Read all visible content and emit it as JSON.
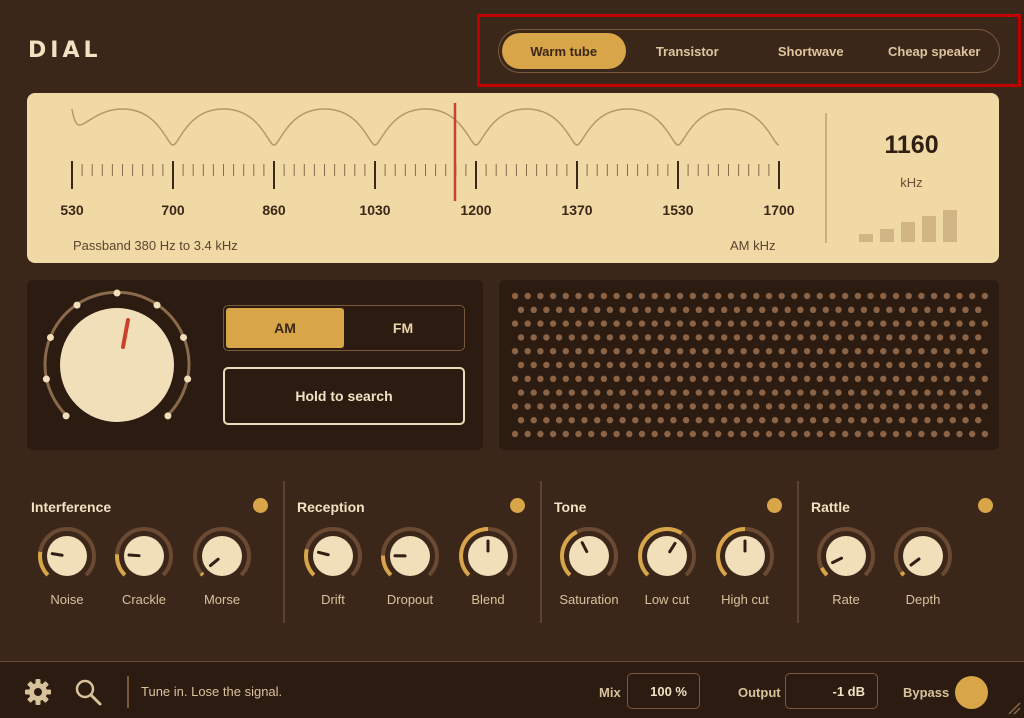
{
  "app": {
    "title": "DIAL"
  },
  "presets": {
    "items": [
      "Warm tube",
      "Transistor",
      "Shortwave",
      "Cheap speaker"
    ],
    "active": "Warm tube"
  },
  "tuner": {
    "tick_labels": [
      "530",
      "700",
      "860",
      "1030",
      "1200",
      "1370",
      "1530",
      "1700"
    ],
    "passband": "Passband 380 Hz to 3.4 kHz",
    "band_unit": "AM  kHz",
    "frequency": "1160",
    "frequency_unit": "kHz",
    "signal_bars_lit": 5,
    "signal_bars_total": 5
  },
  "modes": {
    "items": [
      "AM",
      "FM"
    ],
    "active": "AM"
  },
  "search": {
    "label": "Hold to search"
  },
  "groups": [
    {
      "title": "Interference",
      "knobs": [
        {
          "label": "Noise",
          "value": 0.2
        },
        {
          "label": "Crackle",
          "value": 0.18
        },
        {
          "label": "Morse",
          "value": 0.02
        }
      ]
    },
    {
      "title": "Reception",
      "knobs": [
        {
          "label": "Drift",
          "value": 0.22
        },
        {
          "label": "Dropout",
          "value": 0.17
        },
        {
          "label": "Blend",
          "value": 0.5
        }
      ]
    },
    {
      "title": "Tone",
      "knobs": [
        {
          "label": "Saturation",
          "value": 0.4
        },
        {
          "label": "Low cut",
          "value": 0.62
        },
        {
          "label": "High cut",
          "value": 0.5
        }
      ]
    },
    {
      "title": "Rattle",
      "knobs": [
        {
          "label": "Rate",
          "value": 0.07
        },
        {
          "label": "Depth",
          "value": 0.03
        }
      ]
    }
  ],
  "footer": {
    "tagline": "Tune in. Lose the signal.",
    "mix_label": "Mix",
    "mix_value": "100 %",
    "output_label": "Output",
    "output_value": "-1 dB",
    "bypass_label": "Bypass"
  },
  "colors": {
    "background": "#3b2719",
    "panel": "#2b1b11",
    "accent": "#d8a548",
    "display": "#f0d9a4",
    "needle": "#c9432a",
    "highlight": "#c00000"
  }
}
